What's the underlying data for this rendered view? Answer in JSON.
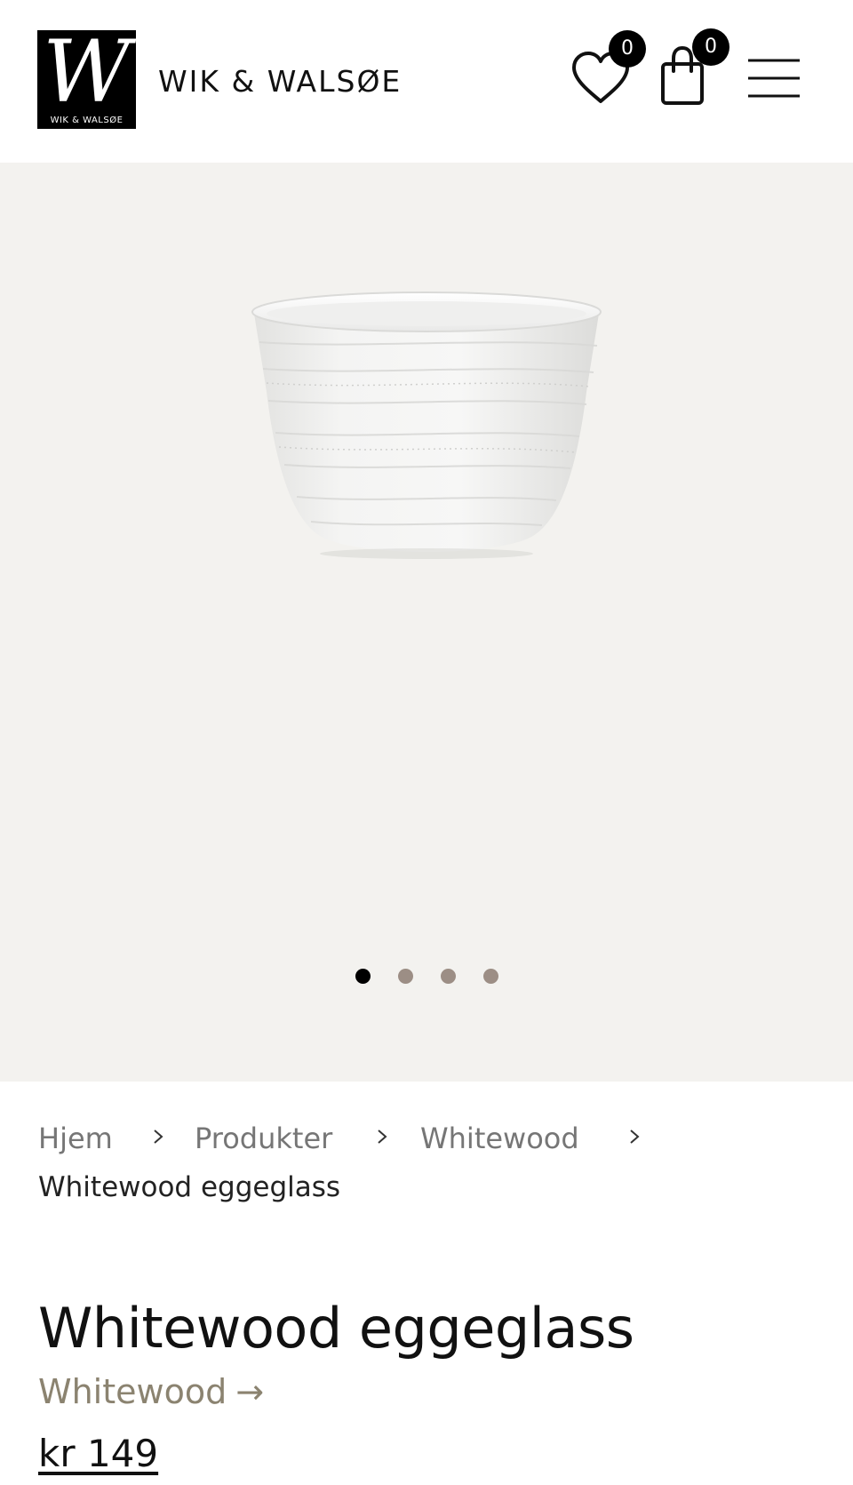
{
  "header": {
    "logo_letter": "W",
    "logo_sub": "WIK & WALSØE",
    "brand_name": "WIK & WALSØE",
    "wishlist_count": "0",
    "cart_count": "0",
    "icons": [
      "heart-icon",
      "shopping-bag-icon",
      "hamburger-menu-icon"
    ]
  },
  "gallery": {
    "image_alt": "Whitewood eggeglass",
    "slide_count": 4,
    "active_slide": 1,
    "colors": {
      "background": "#f3f2ef",
      "dot_active": "#000000",
      "dot_inactive": "#9c8e85"
    }
  },
  "breadcrumb": {
    "items": [
      "Hjem",
      "Produkter",
      "Whitewood"
    ],
    "current": "Whitewood eggeglass"
  },
  "product": {
    "title": "Whitewood eggeglass",
    "collection": "Whitewood",
    "collection_arrow": "→",
    "price": "kr 149",
    "colors": {
      "collection_link": "#8b8370"
    }
  }
}
